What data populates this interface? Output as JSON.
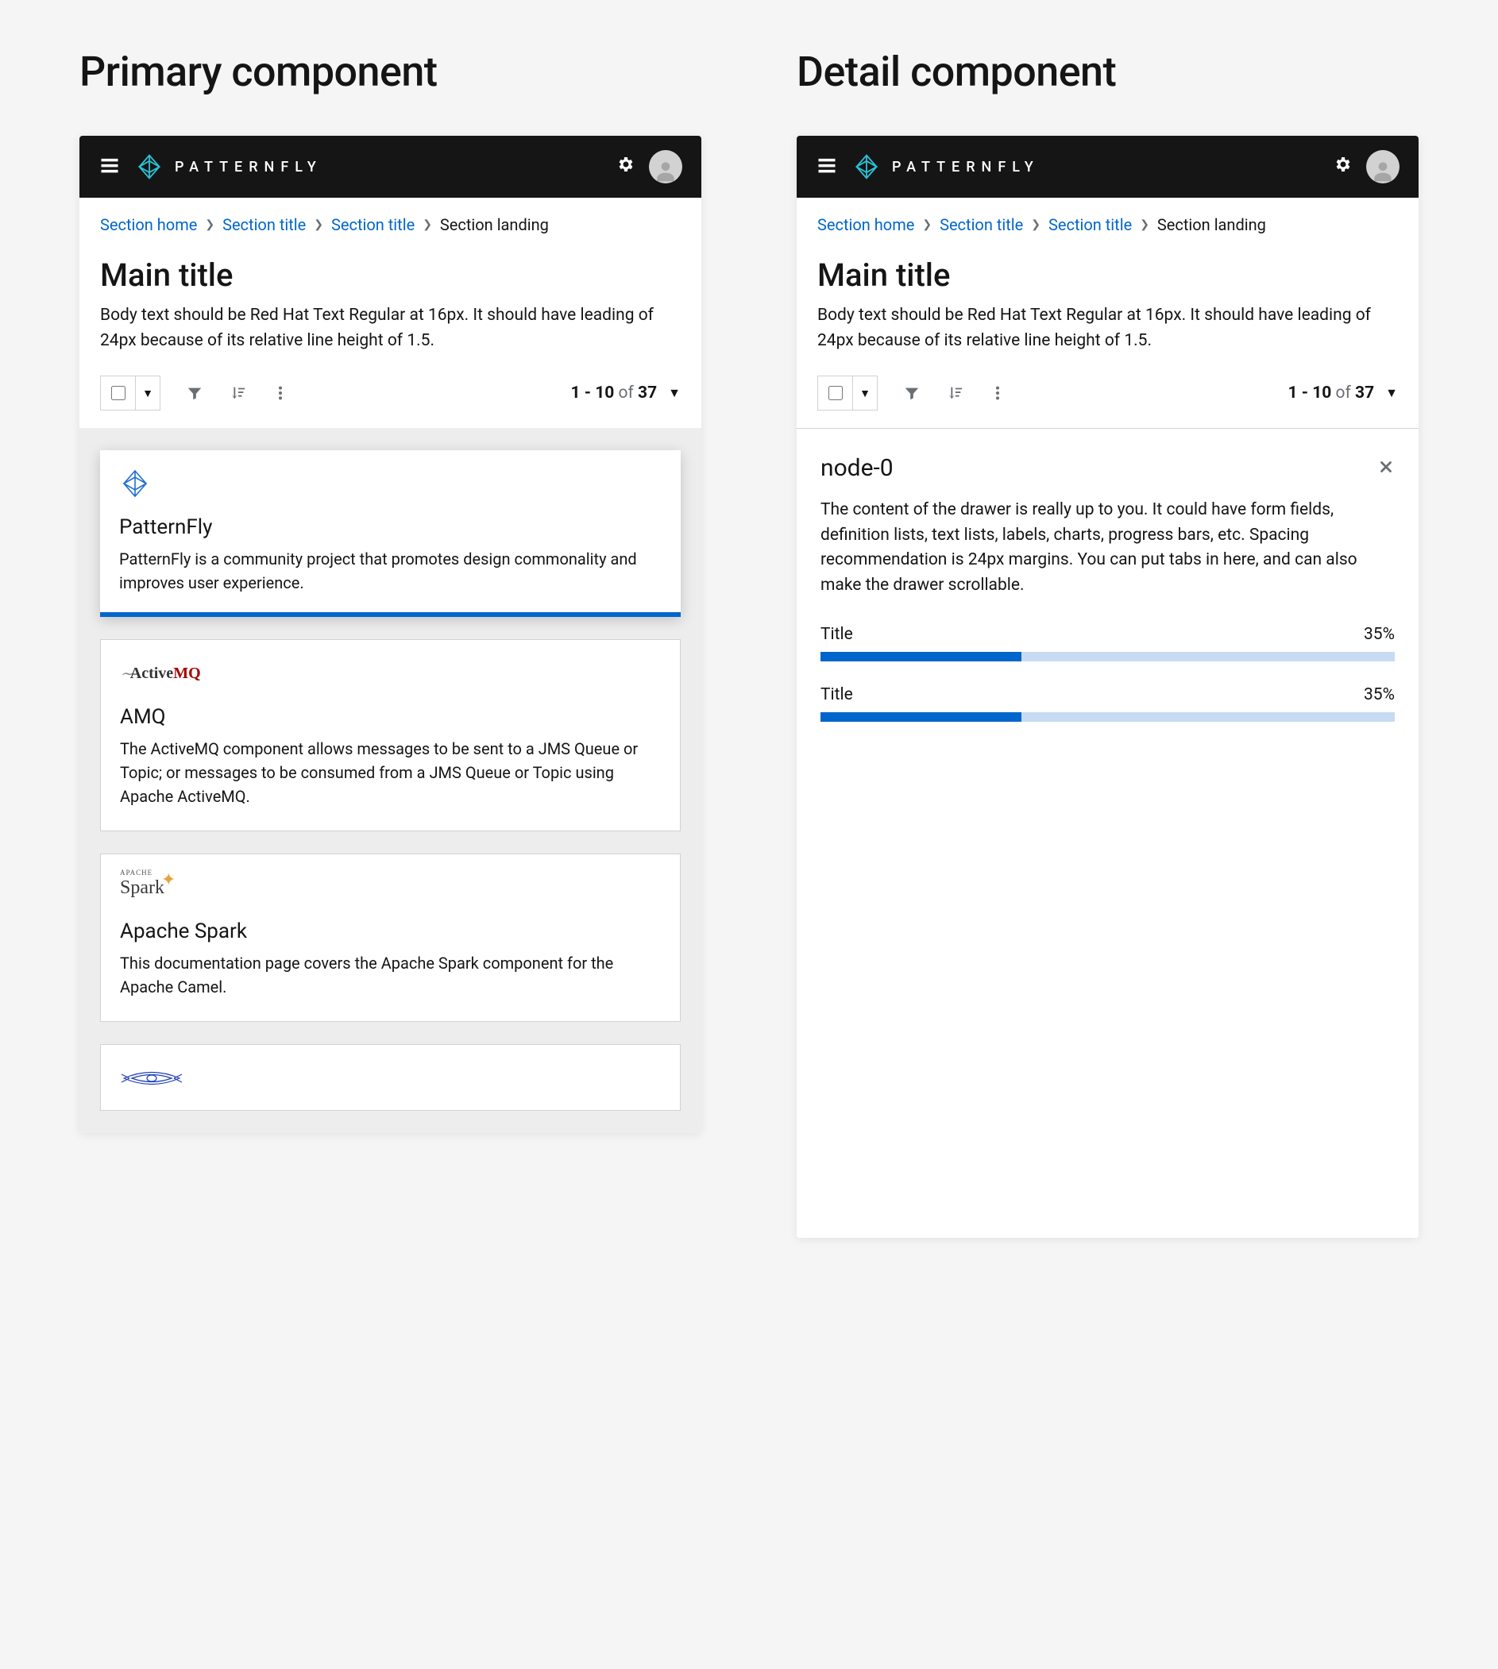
{
  "headings": {
    "primary": "Primary component",
    "detail": "Detail component"
  },
  "brand": "PATTERNFLY",
  "breadcrumb": {
    "items": [
      "Section home",
      "Section title",
      "Section title"
    ],
    "current": "Section landing"
  },
  "page": {
    "title": "Main title",
    "body": "Body text should be Red Hat Text Regular at 16px. It should have leading of 24px because of its relative line height of 1.5."
  },
  "pagination": {
    "range_start": "1",
    "range_end": "10",
    "of_word": "of",
    "total": "37"
  },
  "cards": [
    {
      "title": "PatternFly",
      "desc": "PatternFly is a community project that promotes design commonality and improves user experience."
    },
    {
      "title": "AMQ",
      "desc": "The ActiveMQ component allows messages to be sent to a JMS Queue or Topic; or messages to be consumed from a JMS Queue or Topic using Apache ActiveMQ."
    },
    {
      "title": "Apache Spark",
      "desc": "This documentation page covers the Apache Spark component for the Apache Camel."
    }
  ],
  "amq_logo": {
    "prefix": "Active",
    "suffix": "MQ"
  },
  "spark_logo": {
    "tiny": "APACHE",
    "text": "Spark"
  },
  "drawer": {
    "title": "node-0",
    "body": "The content of the drawer is really up to you. It could have form fields, definition lists, text lists, labels, charts, progress bars, etc. Spacing recommendation is 24px margins. You can put tabs in here, and can also make the drawer scrollable.",
    "progress": [
      {
        "label": "Title",
        "percent": "35%",
        "value": 35
      },
      {
        "label": "Title",
        "percent": "35%",
        "value": 35
      }
    ]
  }
}
